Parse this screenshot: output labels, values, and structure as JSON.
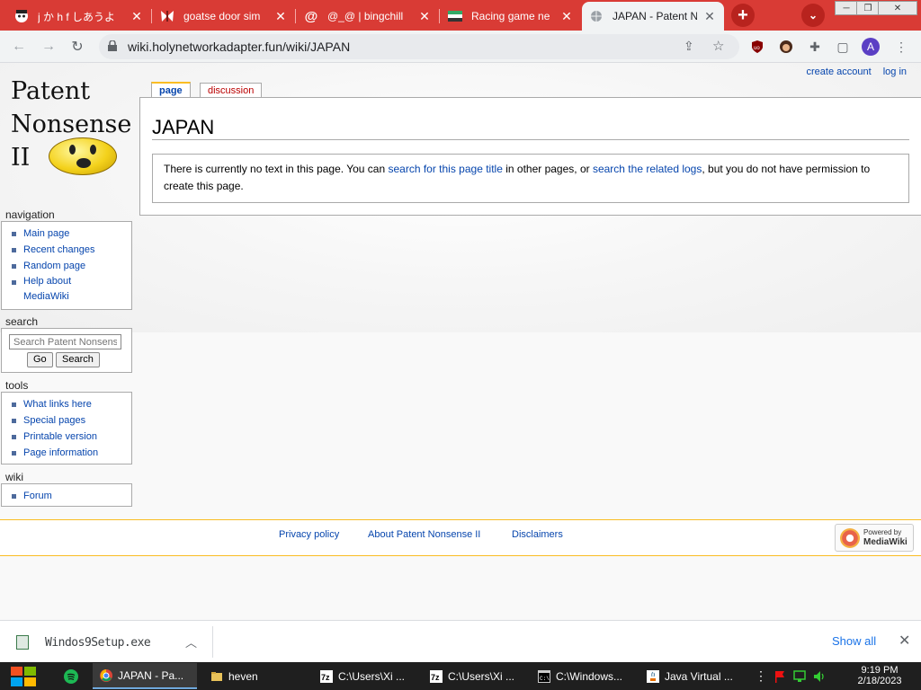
{
  "browser": {
    "tabs": [
      {
        "title": "j か h f しあうよ",
        "icon": "anime-face-icon",
        "active": false
      },
      {
        "title": "goatse door sim",
        "icon": "butterfly-icon",
        "active": false
      },
      {
        "title": "@_@ | bingchill",
        "icon": "at-sign-icon",
        "active": false
      },
      {
        "title": "Racing game ne",
        "icon": "flag-icon",
        "active": false
      },
      {
        "title": "JAPAN - Patent N",
        "icon": "globe-icon",
        "active": true
      }
    ],
    "url": "wiki.holynetworkadapter.fun/wiki/JAPAN",
    "profile_initial": "A"
  },
  "wiki": {
    "personal": {
      "create_account": "create account",
      "log_in": "log in"
    },
    "logo": {
      "line1": "Patent",
      "line2": "Nonsense",
      "line3": "II"
    },
    "tabs": {
      "page": "page",
      "discussion": "discussion"
    },
    "title": "JAPAN",
    "notice": {
      "part1": "There is currently no text in this page. You can ",
      "link1": "search for this page title",
      "part2": " in other pages, or ",
      "link2": "search the related logs",
      "part3": ", but you do not have permission to create this page."
    },
    "navigation": {
      "heading": "navigation",
      "items": [
        "Main page",
        "Recent changes",
        "Random page",
        "Help about",
        "MediaWiki"
      ]
    },
    "search": {
      "heading": "search",
      "placeholder": "Search Patent Nonsense II",
      "go": "Go",
      "search": "Search"
    },
    "tools": {
      "heading": "tools",
      "items": [
        "What links here",
        "Special pages",
        "Printable version",
        "Page information"
      ]
    },
    "wiki_portlet": {
      "heading": "wiki",
      "items": [
        "Forum"
      ]
    },
    "footer": {
      "privacy": "Privacy policy",
      "about": "About Patent Nonsense II",
      "disclaimers": "Disclaimers",
      "powered_line1": "Powered by",
      "powered_line2": "MediaWiki"
    }
  },
  "downloads": {
    "filename": "Windos9Setup.exe",
    "show_all": "Show all"
  },
  "taskbar": {
    "items": [
      {
        "label": "JAPAN - Pa...",
        "active": true
      },
      {
        "label": "heven",
        "active": false
      },
      {
        "label": "C:\\Users\\Xi ...",
        "active": false
      },
      {
        "label": "C:\\Users\\Xi ...",
        "active": false
      },
      {
        "label": "C:\\Windows...",
        "active": false
      },
      {
        "label": "Java Virtual ...",
        "active": false
      }
    ],
    "time": "9:19 PM",
    "date": "2/18/2023"
  },
  "colors": {
    "tabstrip": "#d93b35",
    "link": "#0645ad",
    "redlink": "#ba0000",
    "accent": "#fabd23"
  }
}
